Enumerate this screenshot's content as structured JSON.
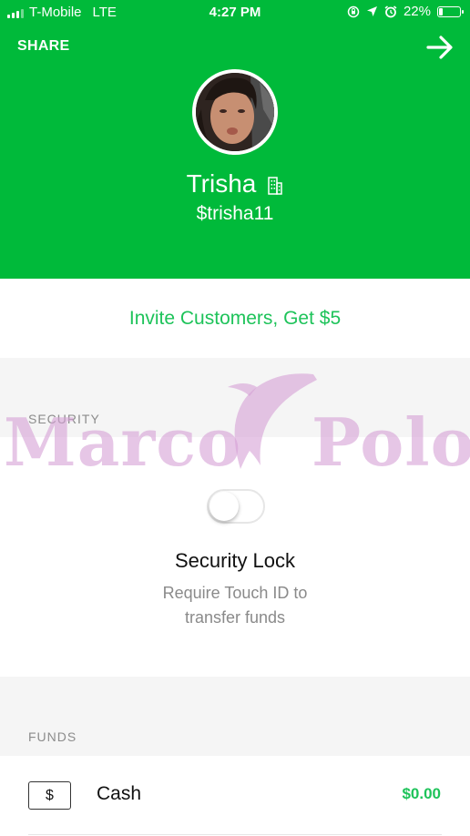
{
  "status_bar": {
    "carrier": "T-Mobile",
    "network": "LTE",
    "time": "4:27 PM",
    "battery": "22%",
    "battery_level": 0.22
  },
  "header": {
    "share_label": "SHARE",
    "name": "Trisha",
    "cashtag": "$trisha11",
    "background_color": "#00ba3a"
  },
  "invite": {
    "label": "Invite Customers, Get $5"
  },
  "security": {
    "section_label": "SECURITY",
    "toggle_on": false,
    "title": "Security Lock",
    "description": "Require Touch ID to transfer funds"
  },
  "funds": {
    "section_label": "FUNDS",
    "items": [
      {
        "icon": "$",
        "label": "Cash",
        "value": "$0.00"
      }
    ]
  },
  "watermark": {
    "left_text": "Marco",
    "right_text": "Polo"
  },
  "icons": {
    "signal": "signal-bars-icon",
    "location": "location-arrow-icon",
    "alarm": "alarm-clock-icon",
    "rotation_lock": "rotation-lock-icon",
    "battery": "battery-icon",
    "forward": "arrow-right-icon",
    "business": "building-icon"
  }
}
